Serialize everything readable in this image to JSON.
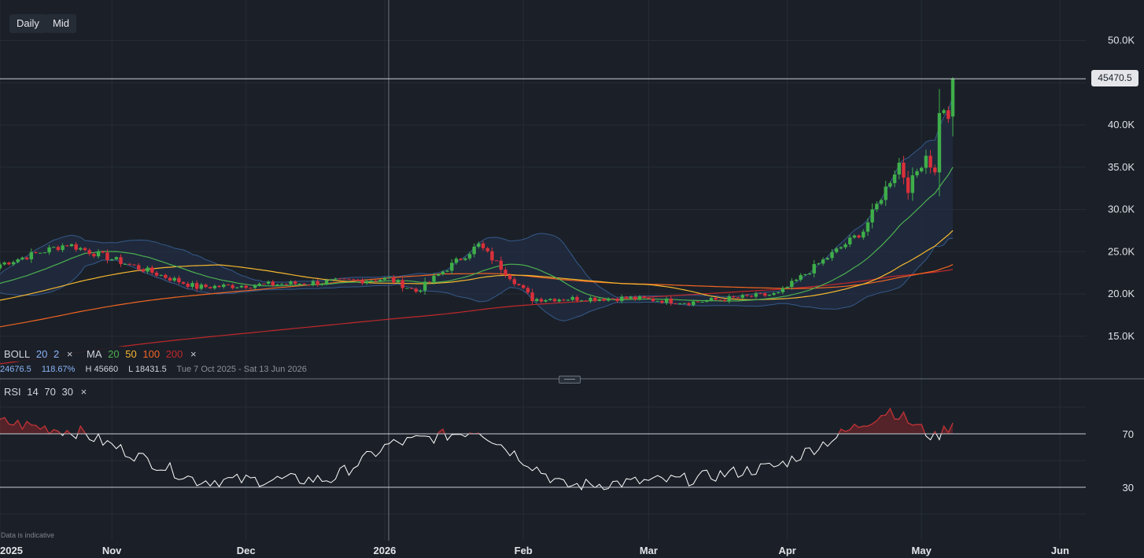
{
  "toolbar": {
    "timeframe": "Daily",
    "price_type": "Mid"
  },
  "price_tag": "45470.5",
  "legend": {
    "boll": {
      "label": "BOLL",
      "period": "20",
      "dev": "2"
    },
    "ma": {
      "label": "MA",
      "periods": [
        "20",
        "50",
        "100",
        "200"
      ]
    },
    "close_symbol": "×"
  },
  "stats": {
    "value": "24676.5",
    "percent": "118.67%",
    "high": "H 45660",
    "low": "L 18431.5",
    "range": "Tue 7 Oct 2025 - Sat 13 Jun 2026"
  },
  "rsi": {
    "label": "RSI",
    "period": "14",
    "upper": "70",
    "lower": "30"
  },
  "disclaimer": "Data is indicative",
  "colors": {
    "background": "#1b2028",
    "up": "#3fae4a",
    "down": "#d9303a",
    "boll_band": "#35598a",
    "ma20": "#4caf50",
    "ma50": "#f5b72e",
    "ma100": "#f26522",
    "ma200": "#c0282b",
    "rsi_line": "#ffffff",
    "rsi_overbought": "#c0282b",
    "period_blue": "#8ab4f8"
  },
  "chart_data": [
    {
      "type": "candlestick",
      "y_ticks": [
        "50.0K",
        "40.0K",
        "35.0K",
        "30.0K",
        "25.0K",
        "20.0K",
        "15.0K"
      ],
      "x_ticks": [
        "2025",
        "Nov",
        "Dec",
        "2026",
        "Feb",
        "Mar",
        "Apr",
        "May",
        "Jun"
      ],
      "ylim": [
        10000,
        52000
      ],
      "last_price": 45470.5,
      "high": 45660,
      "low": 18431.5,
      "indicators": [
        "BOLL 20 2",
        "MA 20",
        "MA 50",
        "MA 100",
        "MA 200"
      ],
      "key_points": [
        {
          "date": "2025-10-07",
          "close": 23500
        },
        {
          "date": "2025-10-22",
          "close": 25900
        },
        {
          "date": "2025-11-20",
          "close": 20800
        },
        {
          "date": "2025-12-15",
          "close": 21300
        },
        {
          "date": "2026-01-02",
          "close": 21800
        },
        {
          "date": "2026-01-08",
          "close": 20300
        },
        {
          "date": "2026-01-22",
          "close": 25800
        },
        {
          "date": "2026-02-03",
          "close": 19400
        },
        {
          "date": "2026-02-25",
          "close": 19500
        },
        {
          "date": "2026-03-10",
          "close": 19000
        },
        {
          "date": "2026-03-30",
          "close": 20000
        },
        {
          "date": "2026-04-18",
          "close": 27500
        },
        {
          "date": "2026-04-26",
          "close": 35500
        },
        {
          "date": "2026-04-28",
          "close": 32500
        },
        {
          "date": "2026-05-02",
          "close": 36500
        },
        {
          "date": "2026-05-04",
          "close": 34200
        },
        {
          "date": "2026-05-05",
          "close": 41800
        },
        {
          "date": "2026-05-07",
          "close": 41000
        },
        {
          "date": "2026-05-08",
          "close": 45470.5
        }
      ]
    },
    {
      "type": "line",
      "name": "RSI 14",
      "levels": [
        70,
        30
      ],
      "y_ticks": [
        "70",
        "30"
      ],
      "key_points": [
        {
          "date": "2025-10-07",
          "rsi": 79
        },
        {
          "date": "2025-10-25",
          "rsi": 71
        },
        {
          "date": "2025-11-20",
          "rsi": 35
        },
        {
          "date": "2025-12-20",
          "rsi": 36
        },
        {
          "date": "2026-01-02",
          "rsi": 62
        },
        {
          "date": "2026-01-22",
          "rsi": 73
        },
        {
          "date": "2026-02-10",
          "rsi": 31
        },
        {
          "date": "2026-03-10",
          "rsi": 36
        },
        {
          "date": "2026-03-30",
          "rsi": 46
        },
        {
          "date": "2026-04-24",
          "rsi": 88
        },
        {
          "date": "2026-05-04",
          "rsi": 67
        },
        {
          "date": "2026-05-08",
          "rsi": 78
        }
      ]
    }
  ]
}
